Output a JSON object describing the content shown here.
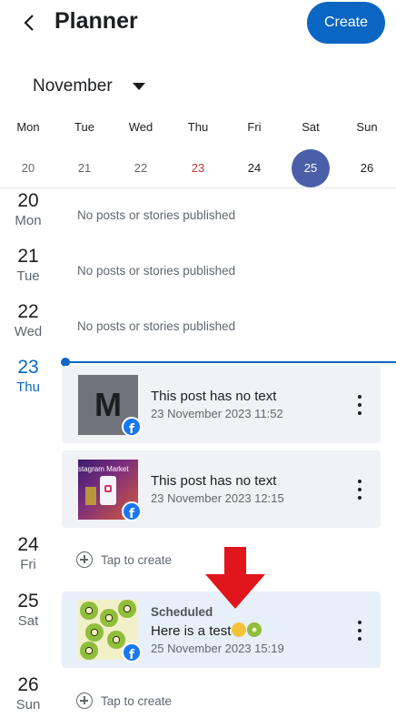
{
  "header": {
    "title": "Planner",
    "create_label": "Create"
  },
  "month": {
    "label": "November"
  },
  "week": [
    {
      "name": "Mon",
      "num": "20"
    },
    {
      "name": "Tue",
      "num": "21"
    },
    {
      "name": "Wed",
      "num": "22"
    },
    {
      "name": "Thu",
      "num": "23"
    },
    {
      "name": "Fri",
      "num": "24"
    },
    {
      "name": "Sat",
      "num": "25"
    },
    {
      "name": "Sun",
      "num": "26"
    }
  ],
  "days": [
    {
      "num": "20",
      "name": "Mon",
      "empty_text": "No posts or stories published"
    },
    {
      "num": "21",
      "name": "Tue",
      "empty_text": "No posts or stories published"
    },
    {
      "num": "22",
      "name": "Wed",
      "empty_text": "No posts or stories published"
    },
    {
      "num": "23",
      "name": "Thu"
    },
    {
      "num": "24",
      "name": "Fri",
      "tap_text": "Tap to create"
    },
    {
      "num": "25",
      "name": "Sat"
    },
    {
      "num": "26",
      "name": "Sun",
      "tap_text": "Tap to create"
    }
  ],
  "posts": [
    {
      "thumb_letter": "M",
      "title": "This post has no text",
      "date": "23 November 2023 11:52"
    },
    {
      "thumb_text": "stagram Market",
      "title": "This post has no text",
      "date": "23 November 2023 12:15"
    },
    {
      "status": "Scheduled",
      "title": "Here is a test",
      "date": "25 November 2023 15:19"
    }
  ],
  "colors": {
    "accent": "#0a66c2",
    "selected_day": "#4a5fa8",
    "highlight_card": "#e7eff8",
    "annotation_arrow": "#e0161c"
  },
  "icons": [
    "back-arrow-icon",
    "caret-down-icon",
    "facebook-icon",
    "more-vertical-icon",
    "plus-circle-icon",
    "smiling-emoji-icon",
    "kiwi-emoji-icon",
    "red-down-arrow-annotation"
  ]
}
